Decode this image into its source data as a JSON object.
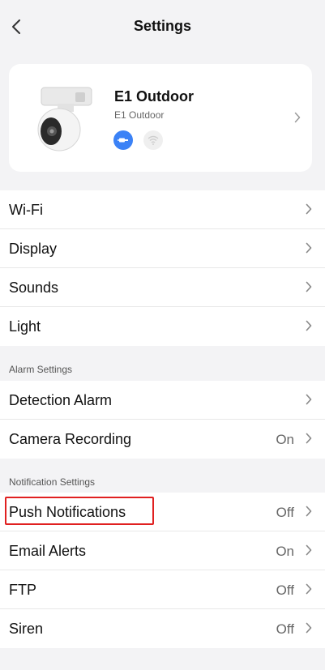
{
  "header": {
    "title": "Settings"
  },
  "device": {
    "name": "E1 Outdoor",
    "model": "E1 Outdoor"
  },
  "groups": [
    {
      "items": [
        {
          "label": "Wi-Fi",
          "value": ""
        },
        {
          "label": "Display",
          "value": ""
        },
        {
          "label": "Sounds",
          "value": ""
        },
        {
          "label": "Light",
          "value": ""
        }
      ]
    },
    {
      "title": "Alarm Settings",
      "items": [
        {
          "label": "Detection Alarm",
          "value": ""
        },
        {
          "label": "Camera Recording",
          "value": "On"
        }
      ]
    },
    {
      "title": "Notification Settings",
      "items": [
        {
          "label": "Push Notifications",
          "value": "Off"
        },
        {
          "label": "Email Alerts",
          "value": "On"
        },
        {
          "label": "FTP",
          "value": "Off"
        },
        {
          "label": "Siren",
          "value": "Off"
        }
      ]
    }
  ],
  "colors": {
    "accent": "#3b82f6",
    "highlight": "#e02020",
    "background": "#f3f3f5"
  }
}
